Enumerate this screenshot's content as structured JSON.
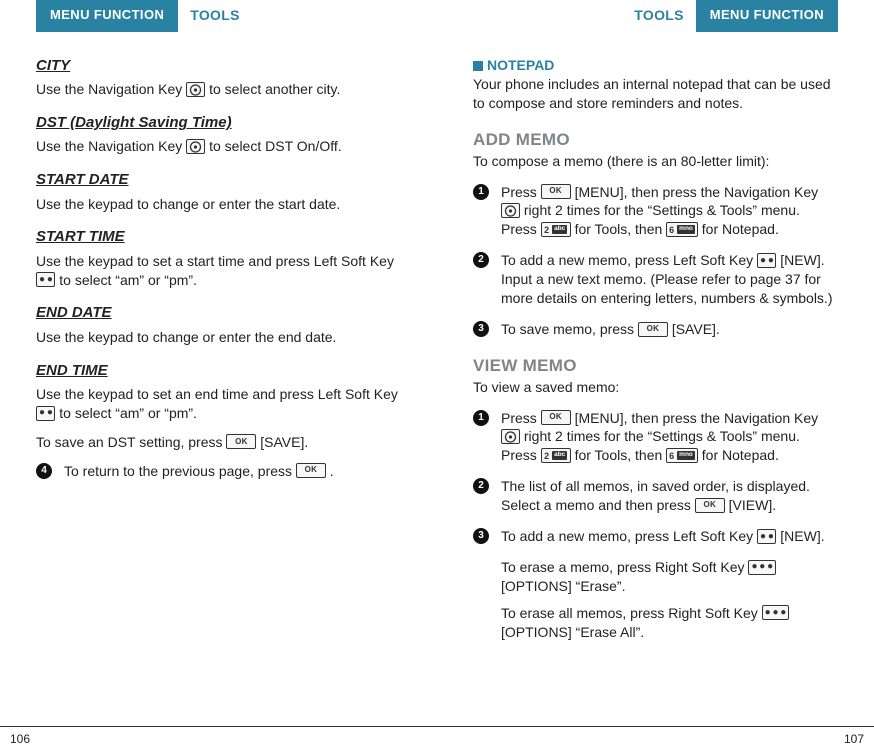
{
  "header": {
    "menu_function": "MENU FUNCTION",
    "tools": "TOOLS"
  },
  "icons": {
    "ok": "OK",
    "key2_num": "2",
    "key2_txt": "abc",
    "key6_num": "6",
    "key6_txt": "mno",
    "two_dot": "● ●",
    "three_dot": "● ● ●"
  },
  "left": {
    "city_h": "CITY",
    "city_p_a": "Use the Navigation Key ",
    "city_p_b": " to select another city.",
    "dst_h": "DST (Daylight Saving Time)",
    "dst_p_a": "Use the Navigation Key ",
    "dst_p_b": " to select DST On/Off.",
    "sdate_h": "START DATE",
    "sdate_p": "Use the keypad to change or enter the start date.",
    "stime_h": "START TIME",
    "stime_p_a": "Use the keypad to set a start time and press Left Soft Key ",
    "stime_p_b": " to select “am” or “pm”.",
    "edate_h": "END DATE",
    "edate_p": "Use the keypad to change or enter the end date.",
    "etime_h": "END TIME",
    "etime_p_a": "Use the keypad to set an end time and press Left Soft Key ",
    "etime_p_b": " to select “am” or “pm”.",
    "save_p_a": "To save an DST setting, press ",
    "save_p_b": " [SAVE].",
    "step4_num": "4",
    "step4_a": "To return to the previous page, press ",
    "step4_b": " ."
  },
  "right": {
    "notepad_h": "NOTEPAD",
    "notepad_p": "Your phone includes an internal notepad that can be used to compose and store reminders and notes.",
    "add_h": "ADD MEMO",
    "add_p": "To compose a memo (there is an 80-letter limit):",
    "a1_num": "1",
    "a1_a": "Press ",
    "a1_b": " [MENU], then press the Navigation Key ",
    "a1_c": " right 2 times for the “Settings & Tools” menu. Press ",
    "a1_d": " for Tools, then ",
    "a1_e": " for Notepad.",
    "a2_num": "2",
    "a2_a": "To add a new memo, press Left Soft Key ",
    "a2_b": " [NEW]. Input a new text memo. (Please refer to page 37 for more details on entering letters, numbers & symbols.)",
    "a3_num": "3",
    "a3_a": "To save memo, press ",
    "a3_b": " [SAVE].",
    "view_h": "VIEW MEMO",
    "view_p": "To view a saved memo:",
    "v1_num": "1",
    "v1_a": "Press ",
    "v1_b": " [MENU], then press the Navigation Key ",
    "v1_c": " right 2 times for the “Settings & Tools” menu. Press ",
    "v1_d": " for Tools, then ",
    "v1_e": " for Notepad.",
    "v2_num": "2",
    "v2_a": "The list of all memos, in saved order, is displayed. Select a memo and then press ",
    "v2_b": " [VIEW].",
    "v3_num": "3",
    "v3_a": "To add a new memo, press Left Soft Key ",
    "v3_b": " [NEW].",
    "v3_p2_a": "To erase a memo, press Right Soft Key ",
    "v3_p2_b": " [OPTIONS] “Erase”.",
    "v3_p3_a": "To erase all memos, press Right Soft Key ",
    "v3_p3_b": " [OPTIONS] “Erase All”."
  },
  "footer": {
    "left_page": "106",
    "right_page": "107"
  }
}
